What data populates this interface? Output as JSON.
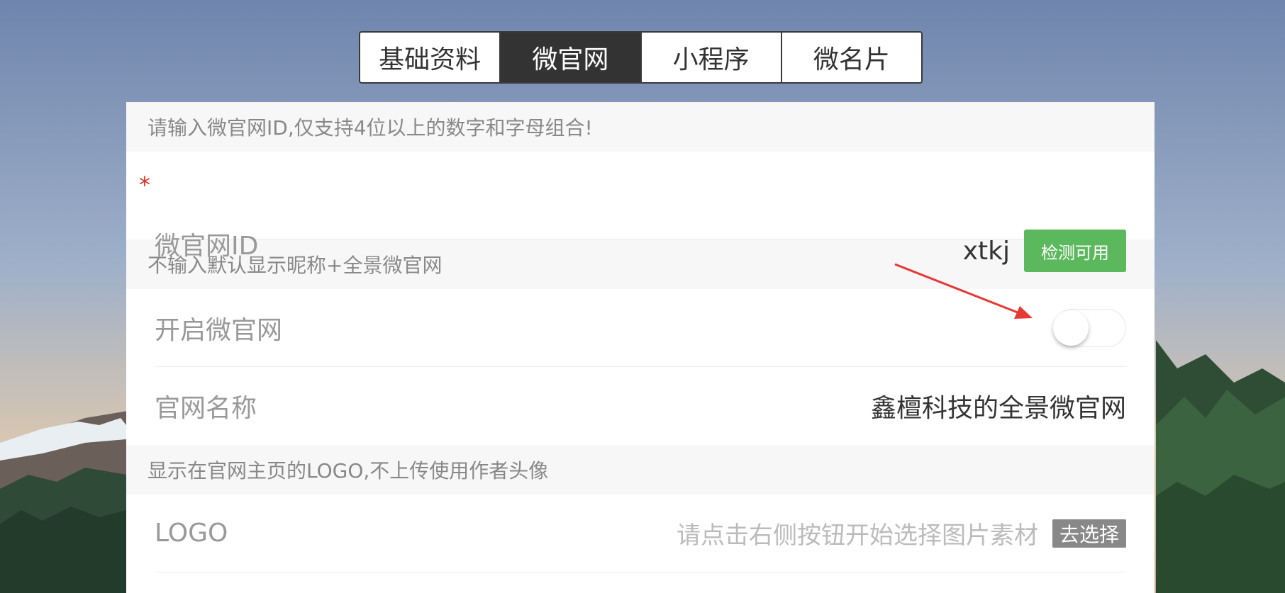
{
  "tabs": [
    {
      "label": "基础资料",
      "active": false
    },
    {
      "label": "微官网",
      "active": true
    },
    {
      "label": "小程序",
      "active": false
    },
    {
      "label": "微名片",
      "active": false
    }
  ],
  "form": {
    "hint_id": "请输入微官网ID,仅支持4位以上的数字和字母组合!",
    "id_row": {
      "required_mark": "*",
      "label": "微官网ID",
      "value": "xtkj",
      "check_button": "检测可用"
    },
    "hint_name": "不输入默认显示昵称+全景微官网",
    "enable_row": {
      "label": "开启微官网",
      "enabled": false
    },
    "name_row": {
      "label": "官网名称",
      "value": "鑫檀科技的全景微官网"
    },
    "hint_logo": "显示在官网主页的LOGO,不上传使用作者头像",
    "logo_row": {
      "label": "LOGO",
      "placeholder": "请点击右侧按钮开始选择图片素材",
      "choose_button": "去选择"
    }
  },
  "colors": {
    "active_tab": "#333333",
    "check_button": "#5cb85c",
    "choose_button": "#888888",
    "required_mark": "#e0302e",
    "annotation_arrow": "#e53935"
  }
}
